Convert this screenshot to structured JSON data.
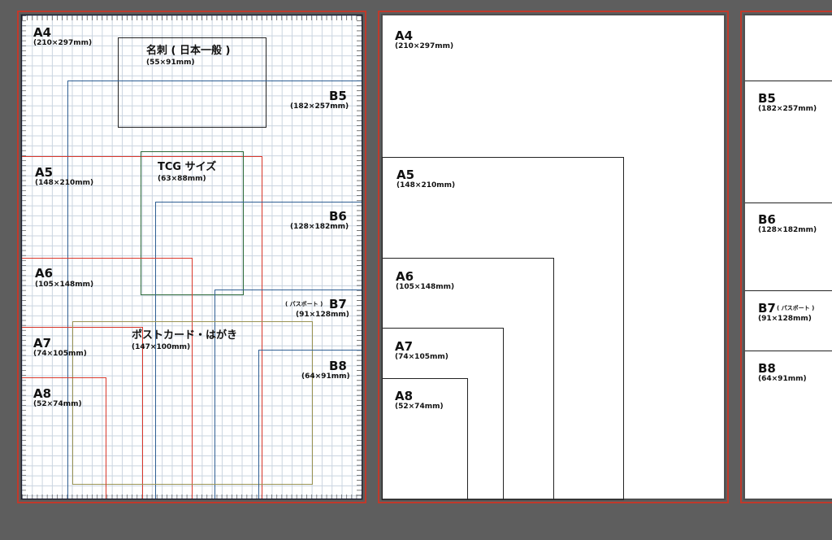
{
  "artboard1": {
    "a4": {
      "name": "A4",
      "size": "(210×297mm)"
    },
    "meishi": {
      "name": "名刺 ( 日本一般 )",
      "size": "(55×91mm)"
    },
    "b5": {
      "name": "B5",
      "size": "(182×257mm)"
    },
    "a5": {
      "name": "A5",
      "size": "(148×210mm)"
    },
    "tcg": {
      "name": "TCG サイズ",
      "size": "(63×88mm)"
    },
    "b6": {
      "name": "B6",
      "size": "(128×182mm)"
    },
    "a6": {
      "name": "A6",
      "size": "(105×148mm)"
    },
    "b7": {
      "name": "B7",
      "note": "( パスポート )",
      "size": "(91×128mm)"
    },
    "a7": {
      "name": "A7",
      "size": "(74×105mm)"
    },
    "postcard": {
      "name": "ポストカード・はがき",
      "size": "(147×100mm)"
    },
    "b8": {
      "name": "B8",
      "size": "(64×91mm)"
    },
    "a8": {
      "name": "A8",
      "size": "(52×74mm)"
    }
  },
  "artboard2": {
    "a4": {
      "name": "A4",
      "size": "(210×297mm)"
    },
    "a5": {
      "name": "A5",
      "size": "(148×210mm)"
    },
    "a6": {
      "name": "A6",
      "size": "(105×148mm)"
    },
    "a7": {
      "name": "A7",
      "size": "(74×105mm)"
    },
    "a8": {
      "name": "A8",
      "size": "(52×74mm)"
    }
  },
  "artboard3": {
    "b5": {
      "name": "B5",
      "size": "(182×257mm)"
    },
    "b6": {
      "name": "B6",
      "size": "(128×182mm)"
    },
    "b7": {
      "name": "B7",
      "note": "( パスポート )",
      "size": "(91×128mm)"
    },
    "b8": {
      "name": "B8",
      "size": "(64×91mm)"
    }
  },
  "colors": {
    "canvas": "#5e5e5e",
    "artboard_outline": "#c0392b",
    "a_series": "#d9382b",
    "b_series": "#2f5f93",
    "tcg": "#2e6b3a",
    "postcard": "#9a9455",
    "meishi": "#222222"
  }
}
